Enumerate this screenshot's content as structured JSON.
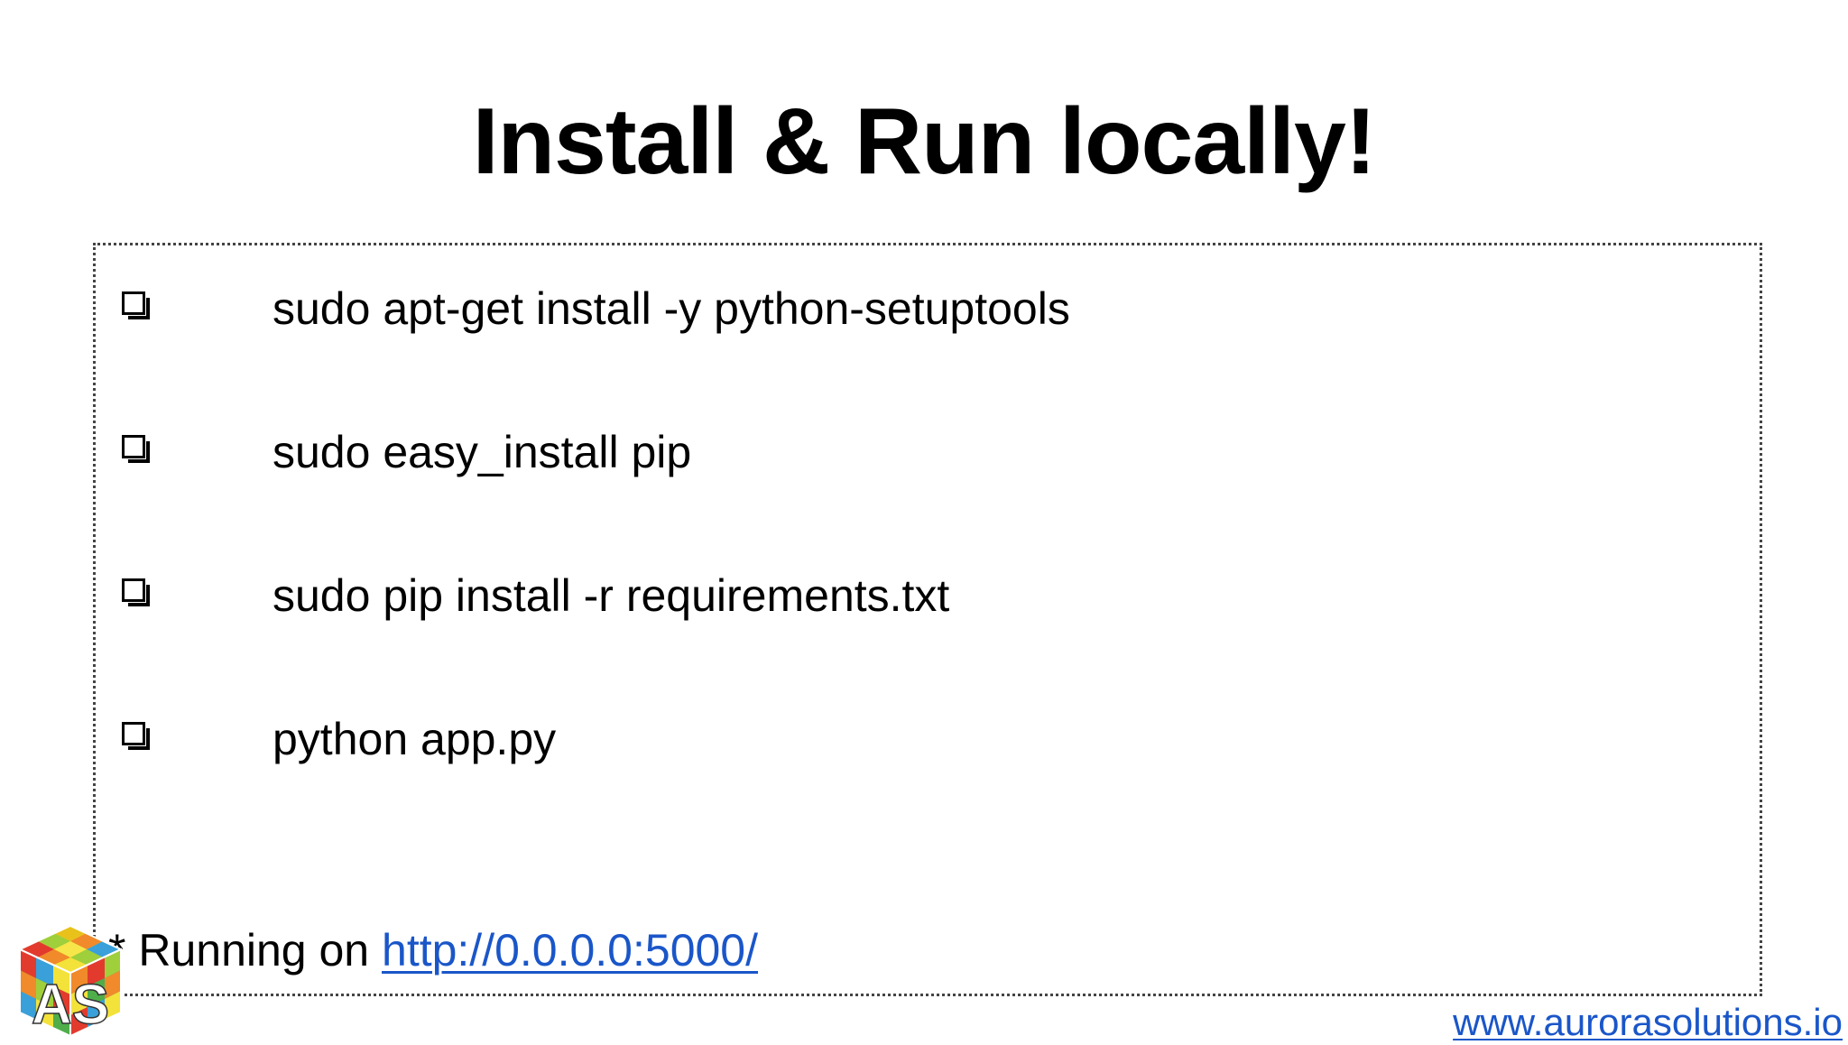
{
  "slide": {
    "title": "Install & Run locally!"
  },
  "steps": [
    {
      "icon": "checkbox-icon",
      "command": "sudo apt-get install -y python-setuptools"
    },
    {
      "icon": "checkbox-icon",
      "command": "sudo easy_install pip"
    },
    {
      "icon": "checkbox-icon",
      "command": "sudo pip install -r requirements.txt"
    },
    {
      "icon": "checkbox-icon",
      "command": "python app.py"
    }
  ],
  "output": {
    "prefix": "* Running on ",
    "url": "http://0.0.0.0:5000/"
  },
  "footer": {
    "website": "www.aurorasolutions.io"
  },
  "logo": {
    "icon": "rubiks-cube-logo-icon",
    "text": "AS"
  },
  "colors": {
    "link": "#1a56c9",
    "text": "#000000",
    "background": "#ffffff",
    "border": "#444444"
  }
}
